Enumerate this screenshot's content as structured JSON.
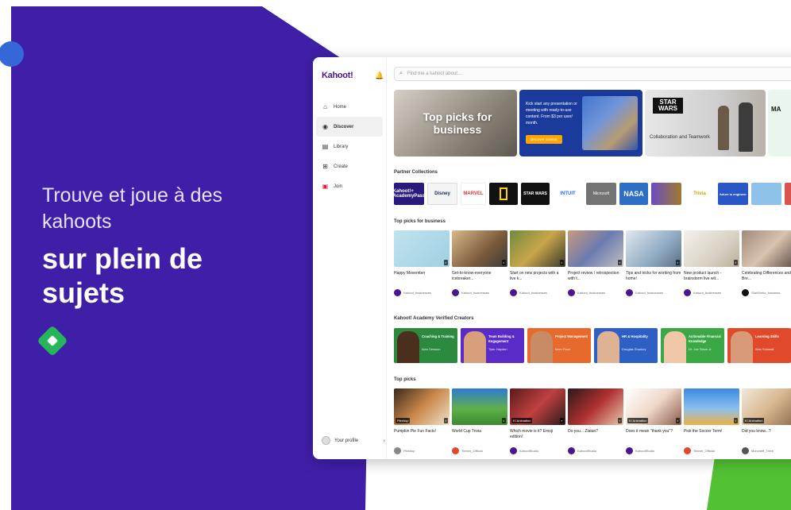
{
  "hero": {
    "subtitle": "Trouve et joue à des kahoots",
    "headline": "sur plein de sujets"
  },
  "colors": {
    "purple": "#3f1fa8",
    "green": "#26b55b",
    "accent": "#46178f"
  },
  "app": {
    "logo": "Kahoot!",
    "search_placeholder": "Find me a kahoot about...",
    "nav": [
      {
        "label": "Home",
        "icon": "home-icon"
      },
      {
        "label": "Discover",
        "icon": "compass-icon"
      },
      {
        "label": "Library",
        "icon": "library-icon"
      },
      {
        "label": "Create",
        "icon": "plus-icon"
      },
      {
        "label": "Join",
        "icon": "join-icon"
      }
    ],
    "profile": "Your profile",
    "banners": {
      "business": "Top picks for business",
      "promo_text": "Kick start any presentation or meeting with ready-to-use content. From $3 per user/ month.",
      "promo_button": "Discover content",
      "starwars_logo": "STAR WARS",
      "starwars_text": "Collaboration and Teamwork",
      "marvel_partial": "MA"
    },
    "sections": {
      "partners": "Partner Collections",
      "business": "Top picks for business",
      "academy": "Kahoot! Academy Verified Creators",
      "top": "Top picks"
    },
    "partners": [
      "Kahoot!+ AcademyPass",
      "Disney",
      "MARVEL",
      "NG",
      "STAR WARS",
      "INTUIT",
      "Microsoft",
      "NASA",
      "",
      "Trivia",
      "future is engineer",
      "",
      ""
    ],
    "business_cards": [
      {
        "title": "Happy Movember",
        "user": "Kahoot_businesses"
      },
      {
        "title": "Get-to-know-everyone icebreaker...",
        "user": "Kahoot_businesses"
      },
      {
        "title": "Start on new projects with a live k...",
        "user": "Kahoot_businesses"
      },
      {
        "title": "Project review / retrospection with t...",
        "user": "Kahoot_businesses"
      },
      {
        "title": "Tips and tricks for working from home!",
        "user": "Kahoot_businesses"
      },
      {
        "title": "New product launch - brainstorm live wit...",
        "user": "Kahoot_businesses"
      },
      {
        "title": "Celebrating Differences and Bre...",
        "user": "SheWorks_business"
      }
    ],
    "creators": [
      {
        "title": "Coaching & Training",
        "name": "Alan Dewson"
      },
      {
        "title": "Team Building & Engagement",
        "name": "Tyler Hayden"
      },
      {
        "title": "Project Management",
        "name": "Marc Pace"
      },
      {
        "title": "HR & Hospitality",
        "name": "Douglas Sharkey"
      },
      {
        "title": "Actionable Financial Knowledge",
        "name": "Dr. Joe Steve Jr."
      },
      {
        "title": "Learning Skills",
        "name": "Wes Schmidt"
      }
    ],
    "top_cards": [
      {
        "title": "Pumpkin Pie Fun Facts!",
        "user": "Pieshop",
        "tag": "Pieshop"
      },
      {
        "title": "World Cup Trivia",
        "user": "Timber_Official",
        "tag": ""
      },
      {
        "title": "Which movie is it? Emoji edition!",
        "user": "KahootStudio",
        "tag": "K! Animation"
      },
      {
        "title": "Do you... Zlatan?",
        "user": "KahootStudio",
        "tag": ""
      },
      {
        "title": "Does it mean \"thank you\"?",
        "user": "KahootStudio",
        "tag": "K! Animation"
      },
      {
        "title": "Pick the Soccer Term!",
        "user": "Timber_Official",
        "tag": ""
      },
      {
        "title": "Did you know...?",
        "user": "Moncrieff_Trent",
        "tag": "K! Animation"
      }
    ]
  }
}
